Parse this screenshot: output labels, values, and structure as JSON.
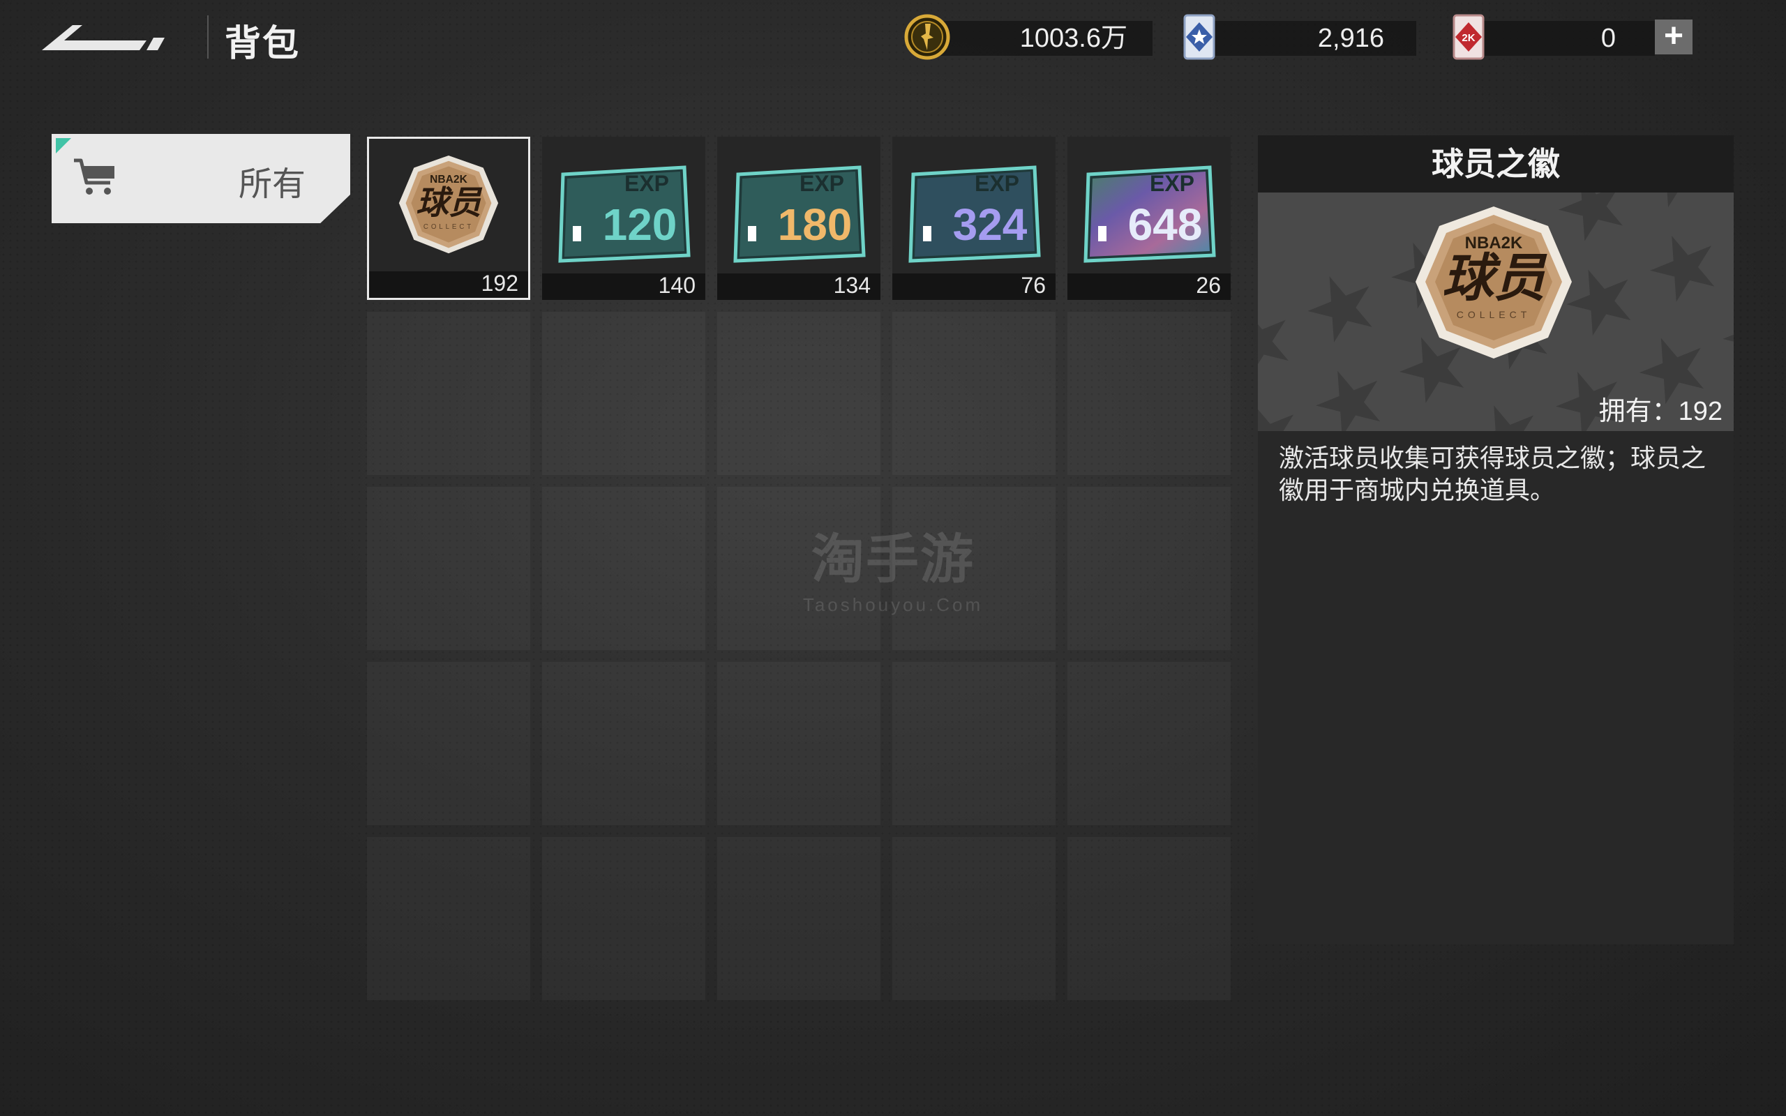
{
  "header": {
    "title": "背包",
    "currencies": [
      {
        "icon": "coin-icon",
        "value": "1003.6万"
      },
      {
        "icon": "star-badge-icon",
        "value": "2,916"
      },
      {
        "icon": "2k-token-icon",
        "value": "0"
      }
    ],
    "plus_label": "+"
  },
  "filter": {
    "label": "所有"
  },
  "items": [
    {
      "name": "player-badge",
      "badge_brand": "NBA2K",
      "badge_text": "球员",
      "badge_sub": "COLLECT",
      "qty": "192",
      "selected": true
    },
    {
      "name": "exp-card-120",
      "card_label": "EXP",
      "card_value": "120",
      "qty": "140",
      "color": "#6fd3c8"
    },
    {
      "name": "exp-card-180",
      "card_label": "EXP",
      "card_value": "180",
      "qty": "134",
      "color": "#f0b86a"
    },
    {
      "name": "exp-card-324",
      "card_label": "EXP",
      "card_value": "324",
      "qty": "76",
      "color": "#a59cf0"
    },
    {
      "name": "exp-card-648",
      "card_label": "EXP",
      "card_value": "648",
      "qty": "26",
      "color": "#c9d6f5"
    }
  ],
  "detail": {
    "title": "球员之徽",
    "badge_brand": "NBA2K",
    "badge_text": "球员",
    "badge_sub": "COLLECT",
    "owned": "拥有：192",
    "description": "激活球员收集可获得球员之徽；球员之徽用于商城内兑换道具。"
  },
  "watermark": {
    "cn": "淘手游",
    "en": "Taoshouyou.Com"
  },
  "colors": {
    "accent": "#41c3a6",
    "badge_gold": "#c9a27a"
  }
}
